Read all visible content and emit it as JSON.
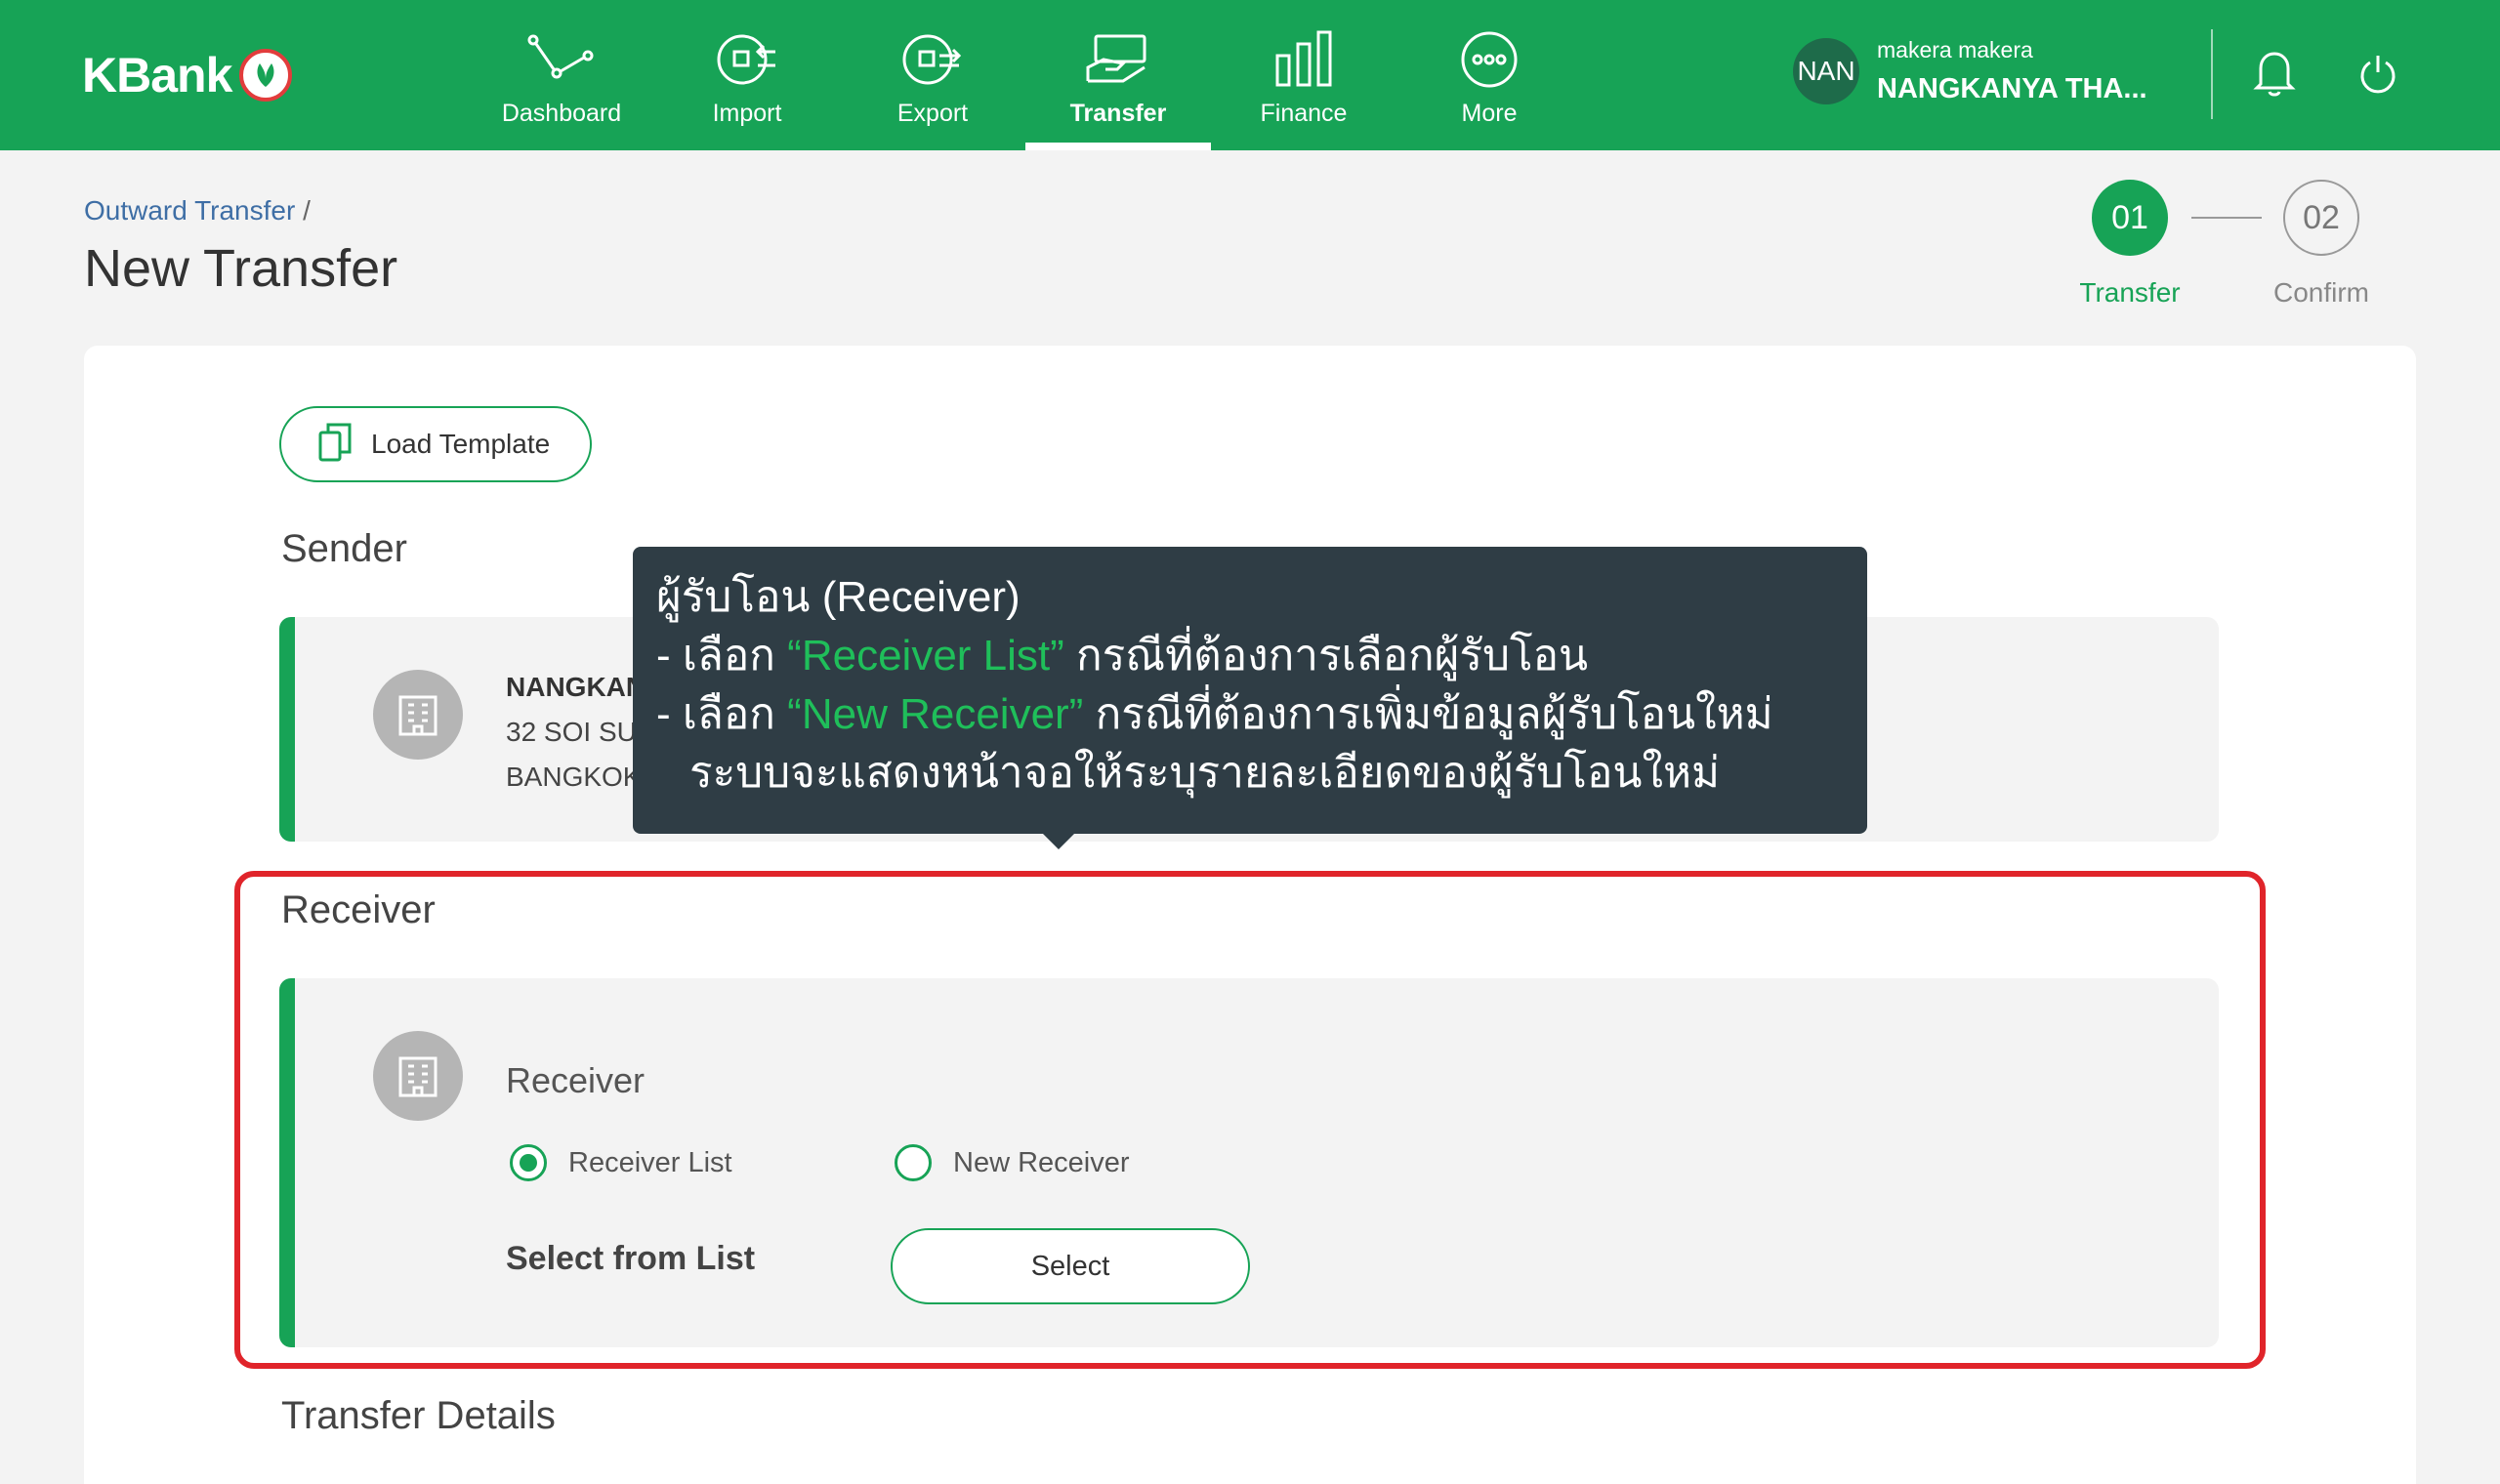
{
  "header": {
    "brand": "KBank",
    "nav": [
      {
        "label": "Dashboard",
        "icon": "dashboard-icon"
      },
      {
        "label": "Import",
        "icon": "import-icon"
      },
      {
        "label": "Export",
        "icon": "export-icon"
      },
      {
        "label": "Transfer",
        "icon": "transfer-icon",
        "active": true
      },
      {
        "label": "Finance",
        "icon": "finance-icon"
      },
      {
        "label": "More",
        "icon": "more-icon"
      }
    ],
    "user": {
      "avatar": "NAN",
      "role": "makera makera",
      "name": "NANGKANYA THA..."
    },
    "colors": {
      "brand_green": "#17a356",
      "highlight_red": "#e0242a",
      "tooltip_bg": "#2f3d45"
    }
  },
  "page": {
    "breadcrumb": "Outward Transfer",
    "breadcrumb_sep": "/",
    "title": "New Transfer"
  },
  "stepper": {
    "steps": [
      {
        "number": "01",
        "label": "Transfer",
        "state": "current"
      },
      {
        "number": "02",
        "label": "Confirm",
        "state": "pending"
      }
    ]
  },
  "form": {
    "load_template": "Load Template",
    "sender": {
      "section_title": "Sender",
      "name": "NANGKAN",
      "address1": "32 SOI SU",
      "address2": "BANGKOK"
    },
    "receiver": {
      "section_title": "Receiver",
      "label": "Receiver",
      "options": [
        {
          "label": "Receiver List",
          "selected": true
        },
        {
          "label": "New Receiver",
          "selected": false
        }
      ],
      "select_label": "Select from List",
      "select_button": "Select"
    },
    "transfer_details_title": "Transfer Details"
  },
  "tooltip": {
    "line1": "ผู้รับโอน (Receiver)",
    "line2_prefix": "- เลือก ",
    "line2_highlight": "“Receiver List”",
    "line2_suffix": " กรณีที่ต้องการเลือกผู้รับโอน",
    "line3_prefix": "- เลือก ",
    "line3_highlight": "“New Receiver”",
    "line3_suffix": " กรณีที่ต้องการเพิ่มข้อมูลผู้รับโอนใหม่",
    "line4": "ระบบจะแสดงหน้าจอให้ระบุรายละเอียดของผู้รับโอนใหม่"
  }
}
